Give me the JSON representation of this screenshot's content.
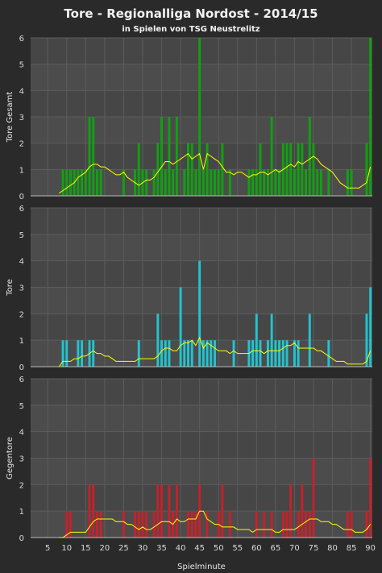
{
  "title": "Tore - Regionalliga Nordost  -  2014/15",
  "subtitle": "in Spielen von TSG Neustrelitz",
  "xlabel": "Spielminute",
  "colors": {
    "background": "#2a2a2a",
    "plot_bg": "#4a4a4a",
    "gesamt": "#12a012",
    "tore": "#22c4d0",
    "gegentore": "#c8202a",
    "trend": "#ffff00",
    "grid": "#5c5c5c"
  },
  "chart_data": [
    {
      "type": "bar",
      "ylabel": "Tore Gesamt",
      "ylim": [
        0,
        6
      ],
      "yticks": [
        0,
        1,
        2,
        3,
        4,
        5,
        6
      ],
      "xticks": [
        5,
        10,
        15,
        20,
        25,
        30,
        35,
        40,
        45,
        50,
        55,
        60,
        65,
        70,
        75,
        80,
        85,
        90
      ],
      "xlim": [
        1,
        90
      ],
      "grid": true,
      "values": [
        0,
        0,
        0,
        0,
        0,
        0,
        0,
        0,
        1,
        1,
        1,
        1,
        1,
        1,
        1,
        3,
        3,
        1,
        1,
        0,
        0,
        0,
        0,
        0,
        1,
        0,
        0,
        1,
        2,
        1,
        1,
        0,
        1,
        2,
        3,
        1,
        3,
        1,
        3,
        0,
        1,
        2,
        2,
        1,
        6,
        1,
        2,
        1,
        1,
        1,
        2,
        0,
        1,
        0,
        0,
        0,
        0,
        1,
        1,
        1,
        2,
        1,
        1,
        3,
        1,
        1,
        2,
        2,
        2,
        1,
        2,
        2,
        1,
        3,
        2,
        1,
        1,
        0,
        1,
        0,
        0,
        0,
        0,
        1,
        1,
        0,
        0,
        0,
        2,
        6
      ],
      "trend": [
        0,
        0,
        0,
        0,
        0,
        0,
        0,
        0.1,
        0.2,
        0.3,
        0.4,
        0.5,
        0.7,
        0.8,
        0.9,
        1.1,
        1.2,
        1.2,
        1.1,
        1.1,
        1.0,
        0.9,
        0.8,
        0.8,
        0.9,
        0.7,
        0.6,
        0.5,
        0.4,
        0.5,
        0.6,
        0.6,
        0.7,
        0.9,
        1.1,
        1.3,
        1.3,
        1.2,
        1.3,
        1.4,
        1.5,
        1.6,
        1.4,
        1.5,
        1.6,
        1.0,
        1.6,
        1.5,
        1.4,
        1.3,
        1.1,
        0.9,
        0.9,
        0.8,
        0.9,
        0.9,
        0.8,
        0.7,
        0.8,
        0.8,
        0.9,
        0.9,
        0.8,
        0.9,
        1.0,
        0.9,
        1.0,
        1.1,
        1.2,
        1.1,
        1.3,
        1.2,
        1.3,
        1.4,
        1.5,
        1.4,
        1.2,
        1.1,
        1.0,
        0.9,
        0.7,
        0.5,
        0.4,
        0.3,
        0.3,
        0.3,
        0.3,
        0.4,
        0.5,
        1.1
      ]
    },
    {
      "type": "bar",
      "ylabel": "Tore",
      "ylim": [
        0,
        6
      ],
      "yticks": [
        0,
        1,
        2,
        3,
        4,
        5,
        6
      ],
      "xticks": [
        5,
        10,
        15,
        20,
        25,
        30,
        35,
        40,
        45,
        50,
        55,
        60,
        65,
        70,
        75,
        80,
        85,
        90
      ],
      "xlim": [
        1,
        90
      ],
      "grid": true,
      "values": [
        0,
        0,
        0,
        0,
        0,
        0,
        0,
        0,
        1,
        1,
        0,
        0,
        1,
        1,
        0,
        1,
        1,
        0,
        0,
        0,
        0,
        0,
        0,
        0,
        0,
        0,
        0,
        0,
        1,
        0,
        0,
        0,
        0,
        2,
        1,
        1,
        1,
        0,
        0,
        3,
        1,
        1,
        1,
        0,
        4,
        1,
        1,
        1,
        1,
        0,
        0,
        0,
        0,
        1,
        0,
        0,
        0,
        1,
        1,
        2,
        1,
        0,
        1,
        2,
        1,
        1,
        1,
        1,
        0,
        1,
        1,
        0,
        0,
        2,
        0,
        0,
        0,
        0,
        1,
        0,
        0,
        0,
        0,
        0,
        0,
        0,
        0,
        0,
        2,
        3
      ],
      "trend": [
        0,
        0,
        0,
        0,
        0,
        0,
        0,
        0,
        0.2,
        0.2,
        0.2,
        0.3,
        0.3,
        0.4,
        0.4,
        0.5,
        0.6,
        0.5,
        0.5,
        0.4,
        0.4,
        0.3,
        0.2,
        0.2,
        0.2,
        0.2,
        0.2,
        0.2,
        0.3,
        0.3,
        0.3,
        0.3,
        0.3,
        0.4,
        0.6,
        0.7,
        0.7,
        0.6,
        0.6,
        0.8,
        0.9,
        0.9,
        1.0,
        0.8,
        1.1,
        0.7,
        0.9,
        0.8,
        0.7,
        0.6,
        0.6,
        0.6,
        0.5,
        0.6,
        0.5,
        0.5,
        0.5,
        0.5,
        0.6,
        0.6,
        0.6,
        0.5,
        0.6,
        0.6,
        0.6,
        0.6,
        0.7,
        0.8,
        0.8,
        0.9,
        0.7,
        0.7,
        0.7,
        0.7,
        0.7,
        0.6,
        0.6,
        0.5,
        0.4,
        0.3,
        0.2,
        0.2,
        0.2,
        0.1,
        0.1,
        0.1,
        0.1,
        0.1,
        0.2,
        0.6
      ]
    },
    {
      "type": "bar",
      "ylabel": "Gegentore",
      "ylim": [
        0,
        6
      ],
      "yticks": [
        0,
        1,
        2,
        3,
        4,
        5,
        6
      ],
      "xticks": [
        5,
        10,
        15,
        20,
        25,
        30,
        35,
        40,
        45,
        50,
        55,
        60,
        65,
        70,
        75,
        80,
        85,
        90
      ],
      "xlim": [
        1,
        90
      ],
      "grid": true,
      "values": [
        0,
        0,
        0,
        0,
        0,
        0,
        0,
        0,
        0,
        1,
        1,
        0,
        0,
        0,
        0,
        2,
        2,
        1,
        1,
        0,
        0,
        0,
        0,
        0,
        1,
        0,
        0,
        1,
        1,
        1,
        1,
        0,
        1,
        2,
        2,
        0,
        2,
        1,
        2,
        0,
        0,
        1,
        1,
        1,
        2,
        0,
        1,
        0,
        0,
        1,
        2,
        0,
        1,
        0,
        0,
        0,
        0,
        0,
        0,
        1,
        0,
        1,
        0,
        1,
        0,
        0,
        1,
        1,
        2,
        0,
        1,
        2,
        1,
        1,
        3,
        0,
        0,
        0,
        0,
        0,
        0,
        0,
        0,
        1,
        1,
        0,
        0,
        0,
        1,
        3
      ],
      "trend": [
        0,
        0,
        0,
        0,
        0,
        0,
        0,
        0,
        0,
        0.1,
        0.2,
        0.2,
        0.2,
        0.2,
        0.2,
        0.4,
        0.6,
        0.7,
        0.7,
        0.7,
        0.7,
        0.7,
        0.6,
        0.6,
        0.6,
        0.5,
        0.5,
        0.4,
        0.3,
        0.4,
        0.3,
        0.3,
        0.4,
        0.5,
        0.6,
        0.6,
        0.6,
        0.5,
        0.7,
        0.6,
        0.6,
        0.7,
        0.7,
        0.7,
        1.0,
        1.0,
        0.7,
        0.6,
        0.5,
        0.5,
        0.4,
        0.4,
        0.4,
        0.4,
        0.3,
        0.3,
        0.3,
        0.3,
        0.2,
        0.3,
        0.3,
        0.3,
        0.3,
        0.3,
        0.2,
        0.2,
        0.3,
        0.3,
        0.3,
        0.3,
        0.4,
        0.5,
        0.6,
        0.7,
        0.7,
        0.7,
        0.6,
        0.6,
        0.6,
        0.5,
        0.5,
        0.4,
        0.3,
        0.3,
        0.3,
        0.2,
        0.2,
        0.2,
        0.3,
        0.5
      ]
    }
  ]
}
